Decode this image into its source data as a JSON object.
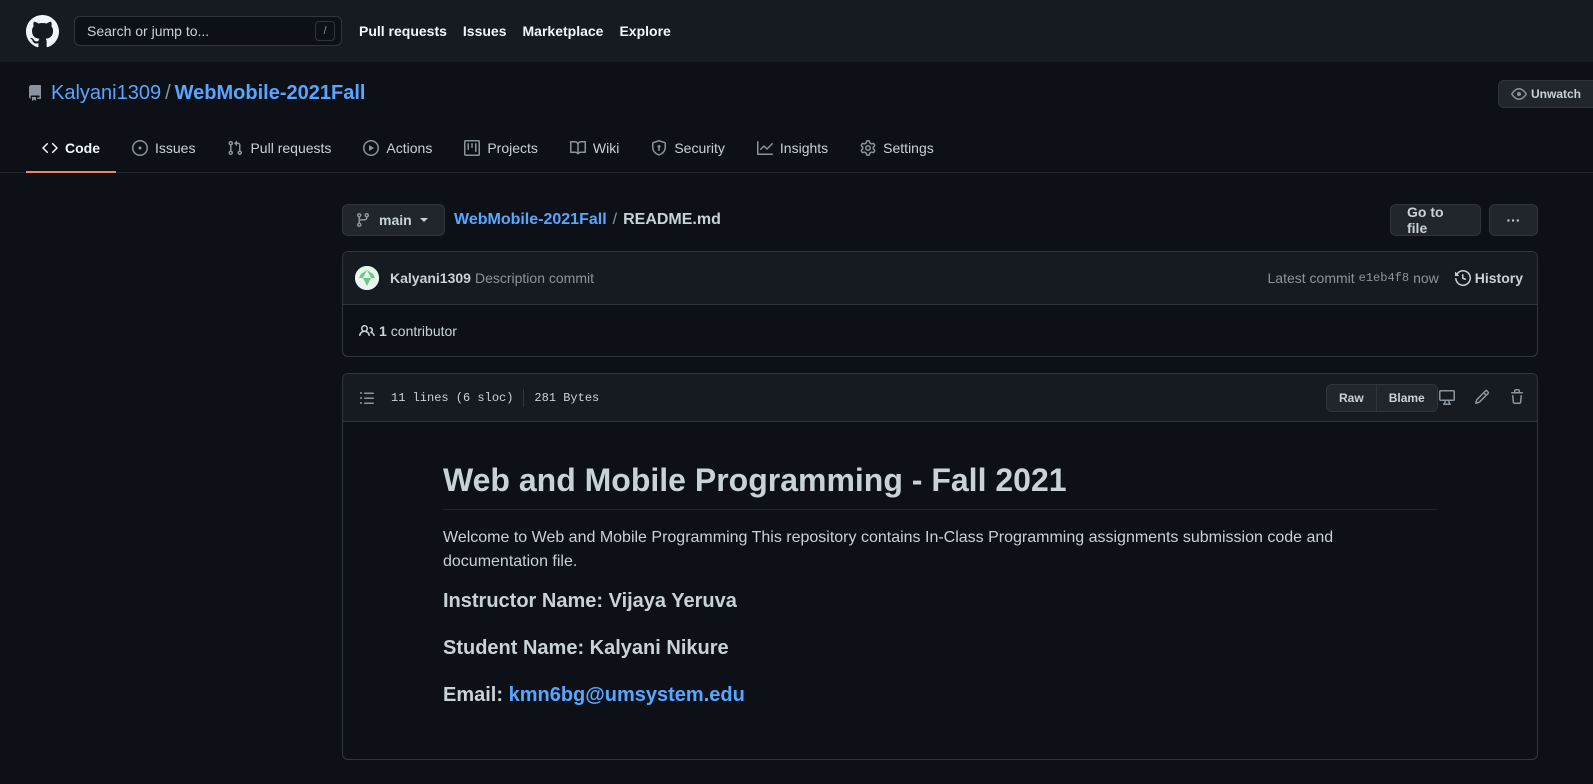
{
  "header": {
    "search_placeholder": "Search or jump to...",
    "search_shortcut": "/",
    "nav": [
      "Pull requests",
      "Issues",
      "Marketplace",
      "Explore"
    ]
  },
  "repo": {
    "owner": "Kalyani1309",
    "separator": "/",
    "name": "WebMobile-2021Fall",
    "watch_label": "Unwatch"
  },
  "tabs": [
    {
      "label": "Code",
      "icon": "code-icon"
    },
    {
      "label": "Issues",
      "icon": "issue-icon"
    },
    {
      "label": "Pull requests",
      "icon": "pull-request-icon"
    },
    {
      "label": "Actions",
      "icon": "play-icon"
    },
    {
      "label": "Projects",
      "icon": "project-icon"
    },
    {
      "label": "Wiki",
      "icon": "book-icon"
    },
    {
      "label": "Security",
      "icon": "shield-icon"
    },
    {
      "label": "Insights",
      "icon": "graph-icon"
    },
    {
      "label": "Settings",
      "icon": "gear-icon"
    }
  ],
  "file_nav": {
    "branch": "main",
    "crumb_repo": "WebMobile-2021Fall",
    "crumb_sep": "/",
    "file_name": "README.md",
    "goto_label": "Go to file",
    "more_label": "···"
  },
  "commit": {
    "author": "Kalyani1309",
    "message": "Description commit",
    "latest_label": "Latest commit",
    "sha": "e1eb4f8",
    "time": "now",
    "history_label": "History",
    "contributors_count": "1",
    "contributors_label": "contributor"
  },
  "file": {
    "lines": "11 lines (6 sloc)",
    "size": "281 Bytes",
    "raw_label": "Raw",
    "blame_label": "Blame"
  },
  "readme": {
    "title": "Web and Mobile Programming - Fall 2021",
    "intro": "Welcome to Web and Mobile Programming This repository contains In-Class Programming assignments submission code and documentation file.",
    "instructor": "Instructor Name: Vijaya Yeruva",
    "student": "Student Name: Kalyani Nikure",
    "email_label": "Email:",
    "email": "kmn6bg@umsystem.edu"
  },
  "colors": {
    "background": "#0d1117",
    "header": "#161b22",
    "link": "#58a6ff",
    "tab_underline": "#f78166"
  }
}
